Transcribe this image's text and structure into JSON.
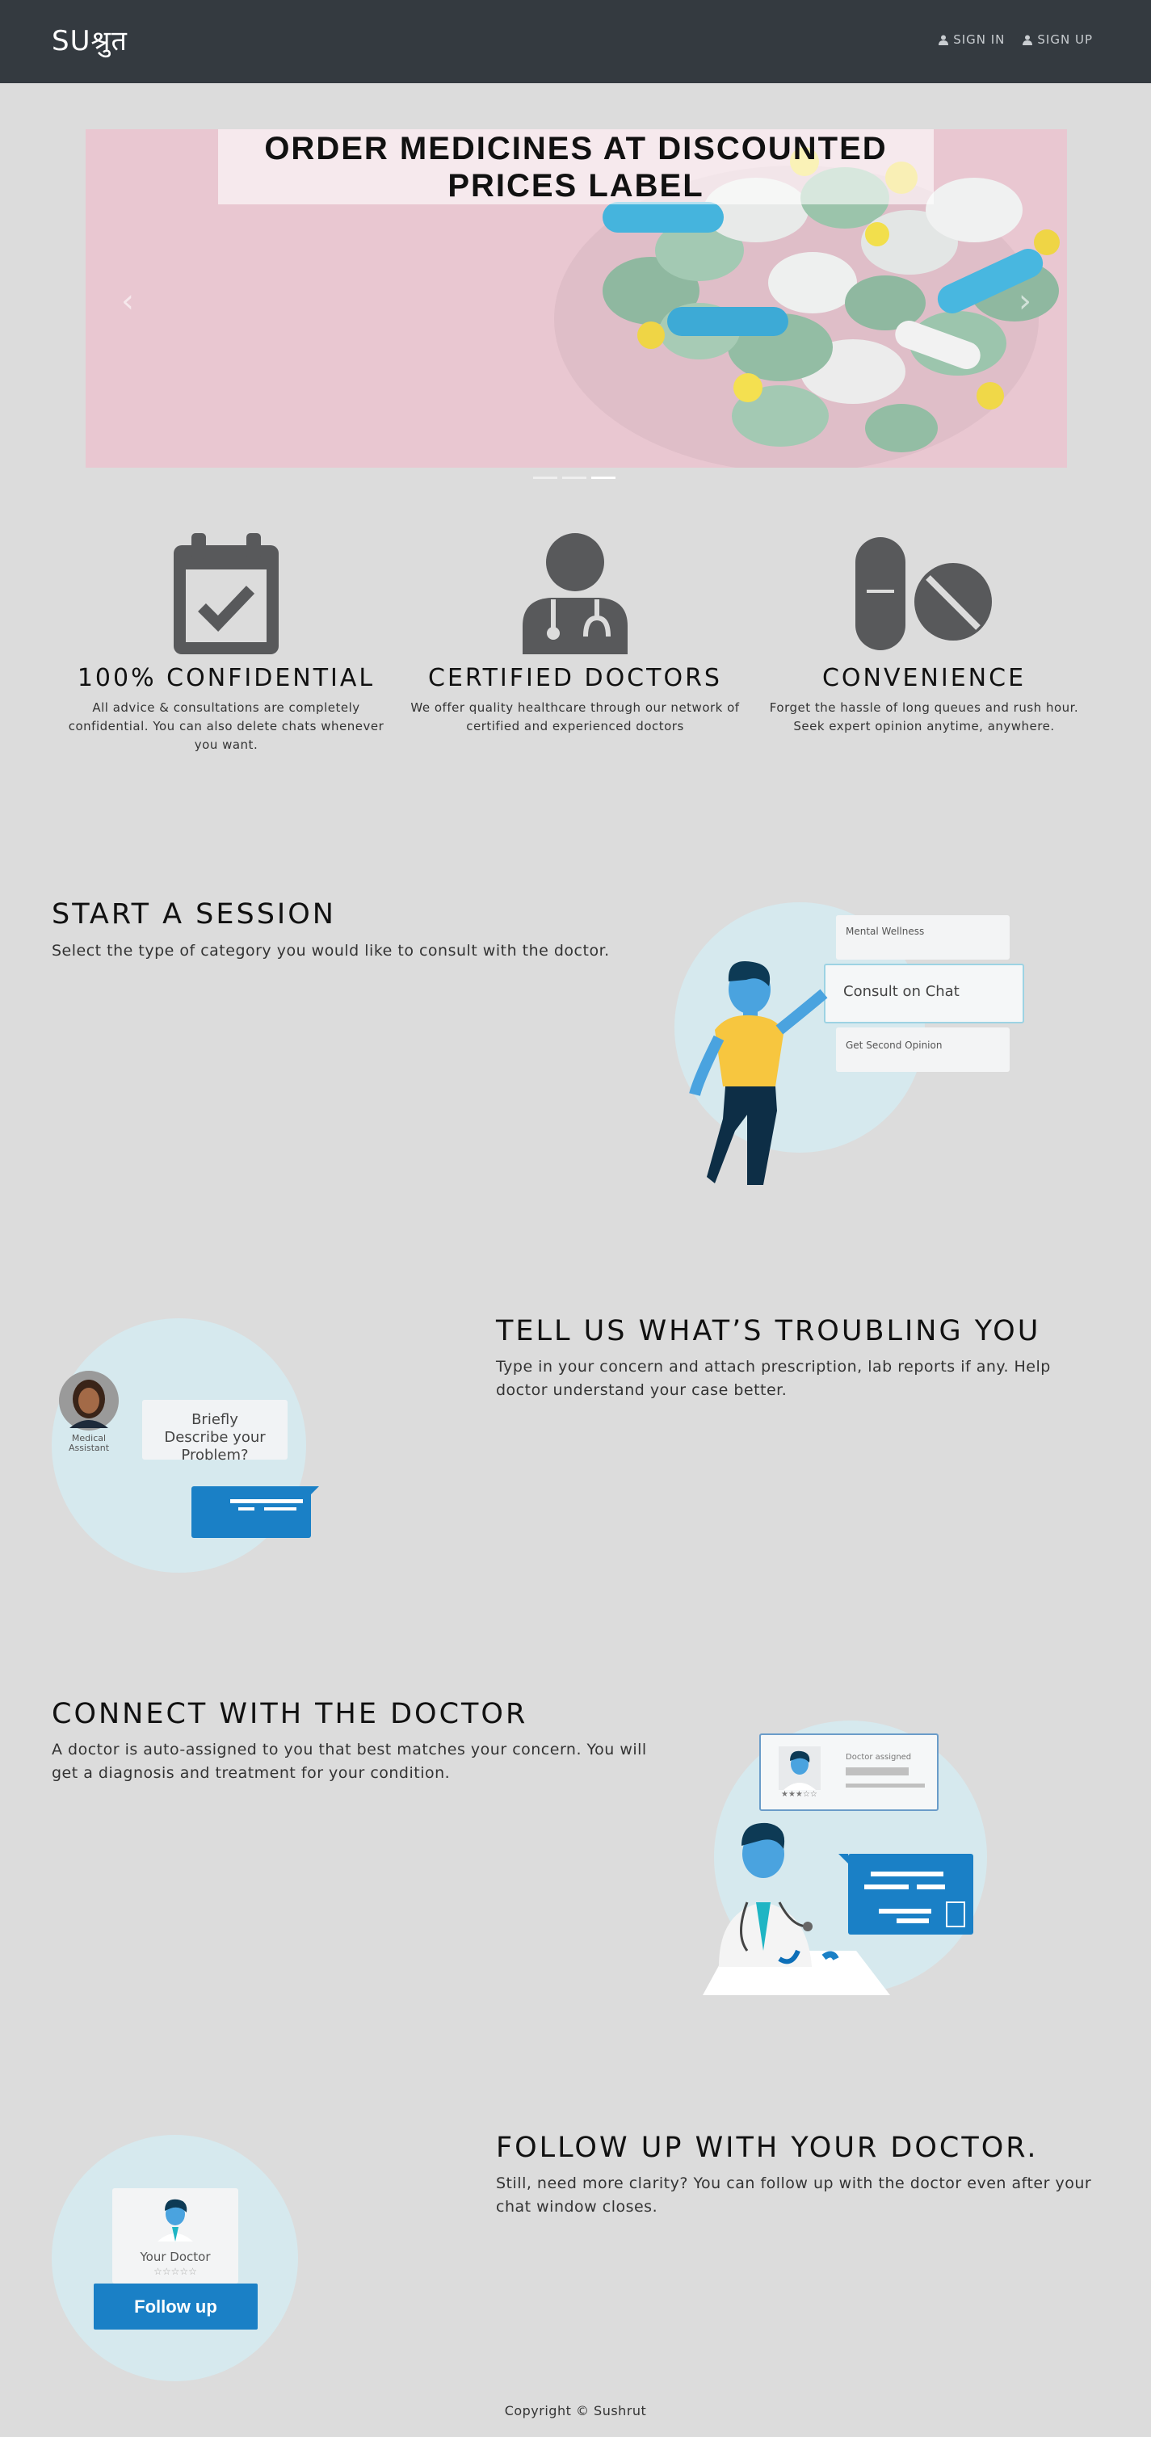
{
  "nav": {
    "brand": "SUश्रुत",
    "sign_in": "SIGN IN",
    "sign_up": "SIGN UP"
  },
  "carousel": {
    "caption": "ORDER MEDICINES AT DISCOUNTED PRICES LABEL",
    "prev": "‹",
    "next": "›",
    "slides_total": 3,
    "active_slide": 3
  },
  "features": [
    {
      "title": "100% CONFIDENTIAL",
      "text": "All advice & consultations are completely confidential. You can also delete chats whenever you want.",
      "icon": "calendar-check-icon"
    },
    {
      "title": "CERTIFIED DOCTORS",
      "text": "We offer quality healthcare through our network of certified and experienced doctors",
      "icon": "doctor-icon"
    },
    {
      "title": "CONVENIENCE",
      "text": "Forget the hassle of long queues and rush hour. Seek expert opinion anytime, anywhere.",
      "icon": "pills-icon"
    }
  ],
  "sections": {
    "start": {
      "title": "START A SESSION",
      "text": "Select the type of category you would like to consult with the doctor.",
      "options": [
        "Mental Wellness",
        "Consult on Chat",
        "Get Second Opinion"
      ]
    },
    "tell": {
      "title": "TELL US WHAT’S TROUBLING YOU",
      "text": "Type in your concern and attach prescription, lab reports if any. Help doctor understand your case better.",
      "assistant_label": "Medical Assistant",
      "bubble": "Briefly Describe your Problem?"
    },
    "connect": {
      "title": "CONNECT WITH THE DOCTOR",
      "text": "A doctor is auto-assigned to you that best matches your concern. You will get a diagnosis and treatment for your condition.",
      "card_label": "Doctor assigned",
      "rating": "★★★☆☆"
    },
    "follow": {
      "title": "FOLLOW UP WITH YOUR DOCTOR.",
      "text": "Still, need more clarity? You can follow up with the doctor even after your chat window closes.",
      "card_label": "Your Doctor",
      "rating": "☆☆☆☆☆",
      "button": "Follow up"
    }
  },
  "footer": "Copyright © Sushrut",
  "colors": {
    "navbar": "#343a40",
    "page_bg": "#dcdcdc",
    "accent_blue": "#1a80c6",
    "circle": "#d6e9ee",
    "shirt": "#f7c63f",
    "skin": "#4aa3df",
    "icon_gray": "#58595b"
  }
}
